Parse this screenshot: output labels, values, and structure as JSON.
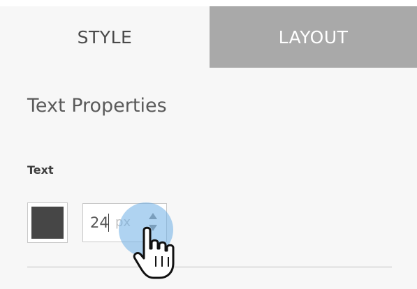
{
  "tabs": [
    {
      "label": "STYLE",
      "active": true
    },
    {
      "label": "LAYOUT",
      "active": false
    }
  ],
  "section": {
    "title": "Text Properties"
  },
  "text_field": {
    "label": "Text",
    "color": "#464646",
    "size_value": "24",
    "size_unit": "px"
  },
  "colors": {
    "active_tab_bg": "#f7f7f7",
    "inactive_tab_bg": "#a9a9a9",
    "hover_halo": "#6eafe6"
  },
  "icons": {
    "stepper": "up-down-arrows-icon",
    "cursor": "hand-pointer-cursor-icon"
  }
}
